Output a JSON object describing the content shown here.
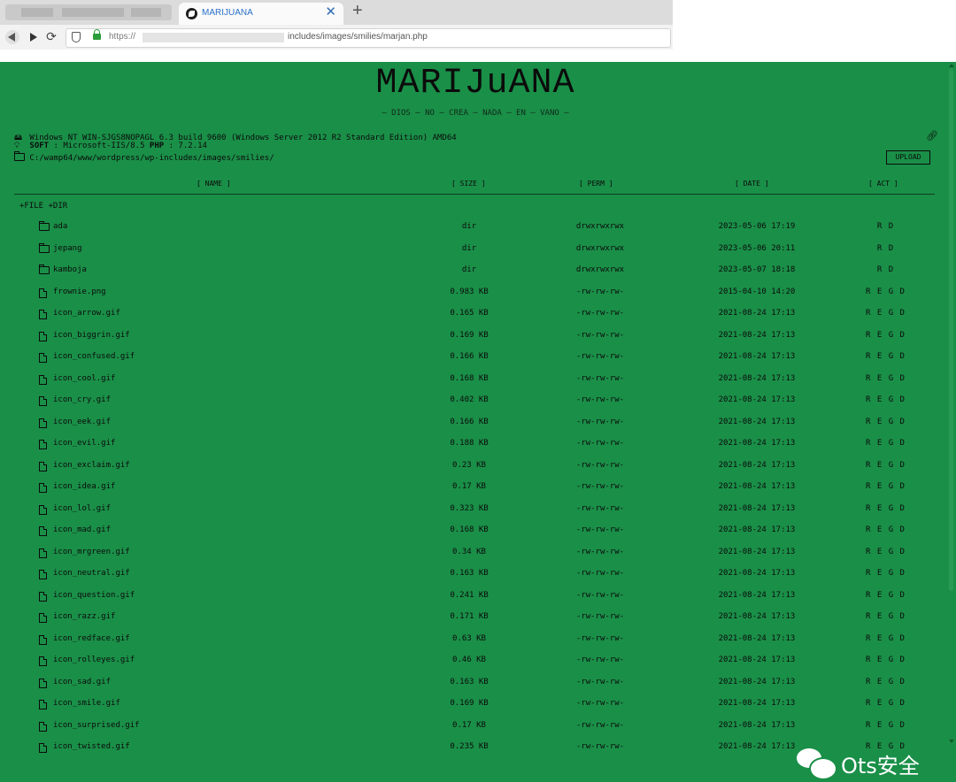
{
  "browser": {
    "tab_title": "MARIJUANA",
    "tab_close": "✕",
    "new_tab": "+",
    "url_scheme": "https://",
    "url_path": "includes/images/smilies/marjan.php"
  },
  "header": {
    "brand": "MARIJuANA",
    "tagline": "– DIOS – NO – CREA – NADA – EN – VANO –"
  },
  "server": {
    "os": "Windows NT WIN-SJGS8NOPAGL 6.3 build 9600 (Windows Server 2012 R2 Standard Edition) AMD64",
    "soft_label": "SOFT",
    "soft_value": ": Microsoft-IIS/8.5",
    "php_label": "PHP",
    "php_value": ": 7.2.14",
    "path": "C:/wamp64/www/wordpress/wp-includes/images/smilies/"
  },
  "upload_label": "UPLOAD",
  "table": {
    "headers": {
      "name": "[ NAME ]",
      "size": "[ SIZE ]",
      "perm": "[ PERM ]",
      "date": "[ DATE ]",
      "act": "[ ACT ]"
    },
    "actions": "+FILE +DIR",
    "rows": [
      {
        "type": "dir",
        "name": "ada",
        "size": "dir",
        "perm": "drwxrwxrwx",
        "date": "2023-05-06 17:19",
        "act": "R D"
      },
      {
        "type": "dir",
        "name": "jepang",
        "size": "dir",
        "perm": "drwxrwxrwx",
        "date": "2023-05-06 20:11",
        "act": "R D"
      },
      {
        "type": "dir",
        "name": "kamboja",
        "size": "dir",
        "perm": "drwxrwxrwx",
        "date": "2023-05-07 18:18",
        "act": "R D"
      },
      {
        "type": "file",
        "name": "frownie.png",
        "size": "0.983 KB",
        "perm": "-rw-rw-rw-",
        "date": "2015-04-10 14:20",
        "act": "R E G D"
      },
      {
        "type": "file",
        "name": "icon_arrow.gif",
        "size": "0.165 KB",
        "perm": "-rw-rw-rw-",
        "date": "2021-08-24 17:13",
        "act": "R E G D"
      },
      {
        "type": "file",
        "name": "icon_biggrin.gif",
        "size": "0.169 KB",
        "perm": "-rw-rw-rw-",
        "date": "2021-08-24 17:13",
        "act": "R E G D"
      },
      {
        "type": "file",
        "name": "icon_confused.gif",
        "size": "0.166 KB",
        "perm": "-rw-rw-rw-",
        "date": "2021-08-24 17:13",
        "act": "R E G D"
      },
      {
        "type": "file",
        "name": "icon_cool.gif",
        "size": "0.168 KB",
        "perm": "-rw-rw-rw-",
        "date": "2021-08-24 17:13",
        "act": "R E G D"
      },
      {
        "type": "file",
        "name": "icon_cry.gif",
        "size": "0.402 KB",
        "perm": "-rw-rw-rw-",
        "date": "2021-08-24 17:13",
        "act": "R E G D"
      },
      {
        "type": "file",
        "name": "icon_eek.gif",
        "size": "0.166 KB",
        "perm": "-rw-rw-rw-",
        "date": "2021-08-24 17:13",
        "act": "R E G D"
      },
      {
        "type": "file",
        "name": "icon_evil.gif",
        "size": "0.188 KB",
        "perm": "-rw-rw-rw-",
        "date": "2021-08-24 17:13",
        "act": "R E G D"
      },
      {
        "type": "file",
        "name": "icon_exclaim.gif",
        "size": "0.23 KB",
        "perm": "-rw-rw-rw-",
        "date": "2021-08-24 17:13",
        "act": "R E G D"
      },
      {
        "type": "file",
        "name": "icon_idea.gif",
        "size": "0.17 KB",
        "perm": "-rw-rw-rw-",
        "date": "2021-08-24 17:13",
        "act": "R E G D"
      },
      {
        "type": "file",
        "name": "icon_lol.gif",
        "size": "0.323 KB",
        "perm": "-rw-rw-rw-",
        "date": "2021-08-24 17:13",
        "act": "R E G D"
      },
      {
        "type": "file",
        "name": "icon_mad.gif",
        "size": "0.168 KB",
        "perm": "-rw-rw-rw-",
        "date": "2021-08-24 17:13",
        "act": "R E G D"
      },
      {
        "type": "file",
        "name": "icon_mrgreen.gif",
        "size": "0.34 KB",
        "perm": "-rw-rw-rw-",
        "date": "2021-08-24 17:13",
        "act": "R E G D"
      },
      {
        "type": "file",
        "name": "icon_neutral.gif",
        "size": "0.163 KB",
        "perm": "-rw-rw-rw-",
        "date": "2021-08-24 17:13",
        "act": "R E G D"
      },
      {
        "type": "file",
        "name": "icon_question.gif",
        "size": "0.241 KB",
        "perm": "-rw-rw-rw-",
        "date": "2021-08-24 17:13",
        "act": "R E G D"
      },
      {
        "type": "file",
        "name": "icon_razz.gif",
        "size": "0.171 KB",
        "perm": "-rw-rw-rw-",
        "date": "2021-08-24 17:13",
        "act": "R E G D"
      },
      {
        "type": "file",
        "name": "icon_redface.gif",
        "size": "0.63 KB",
        "perm": "-rw-rw-rw-",
        "date": "2021-08-24 17:13",
        "act": "R E G D"
      },
      {
        "type": "file",
        "name": "icon_rolleyes.gif",
        "size": "0.46 KB",
        "perm": "-rw-rw-rw-",
        "date": "2021-08-24 17:13",
        "act": "R E G D"
      },
      {
        "type": "file",
        "name": "icon_sad.gif",
        "size": "0.163 KB",
        "perm": "-rw-rw-rw-",
        "date": "2021-08-24 17:13",
        "act": "R E G D"
      },
      {
        "type": "file",
        "name": "icon_smile.gif",
        "size": "0.169 KB",
        "perm": "-rw-rw-rw-",
        "date": "2021-08-24 17:13",
        "act": "R E G D"
      },
      {
        "type": "file",
        "name": "icon_surprised.gif",
        "size": "0.17 KB",
        "perm": "-rw-rw-rw-",
        "date": "2021-08-24 17:13",
        "act": "R E G D"
      },
      {
        "type": "file",
        "name": "icon_twisted.gif",
        "size": "0.235 KB",
        "perm": "-rw-rw-rw-",
        "date": "2021-08-24 17:13",
        "act": "R E G D"
      }
    ]
  },
  "watermark": "Ots安全",
  "colors": {
    "page_bg": "#1a8f48",
    "text": "#0b0b0b",
    "tab_accent": "#2a6fc9"
  }
}
